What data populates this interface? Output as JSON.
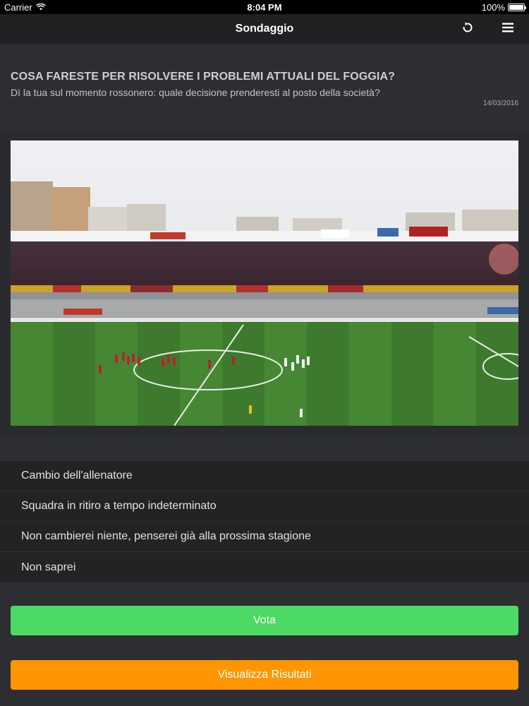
{
  "status": {
    "carrier": "Carrier",
    "time": "8:04 PM",
    "battery": "100%"
  },
  "navbar": {
    "title": "Sondaggio",
    "refresh_icon": "refresh-icon",
    "menu_icon": "hamburger-menu-icon"
  },
  "poll": {
    "title": "COSA FARESTE PER RISOLVERE I PROBLEMI ATTUALI DEL FOGGIA?",
    "subtitle": "Dì la tua sul momento rossonero: quale decisione prenderesti al posto della società?",
    "date": "14/03/2016"
  },
  "options": [
    {
      "label": "Cambio dell'allenatore"
    },
    {
      "label": "Squadra in ritiro a tempo indeterminato"
    },
    {
      "label": "Non cambierei niente, penserei già alla prossima stagione"
    },
    {
      "label": "Non saprei"
    }
  ],
  "buttons": {
    "vote": "Vota",
    "results": "Visualizza Risultati"
  },
  "colors": {
    "vote": "#4cd964",
    "results": "#ff9500",
    "navbar": "#1f2022",
    "background": "#2d2e31"
  }
}
